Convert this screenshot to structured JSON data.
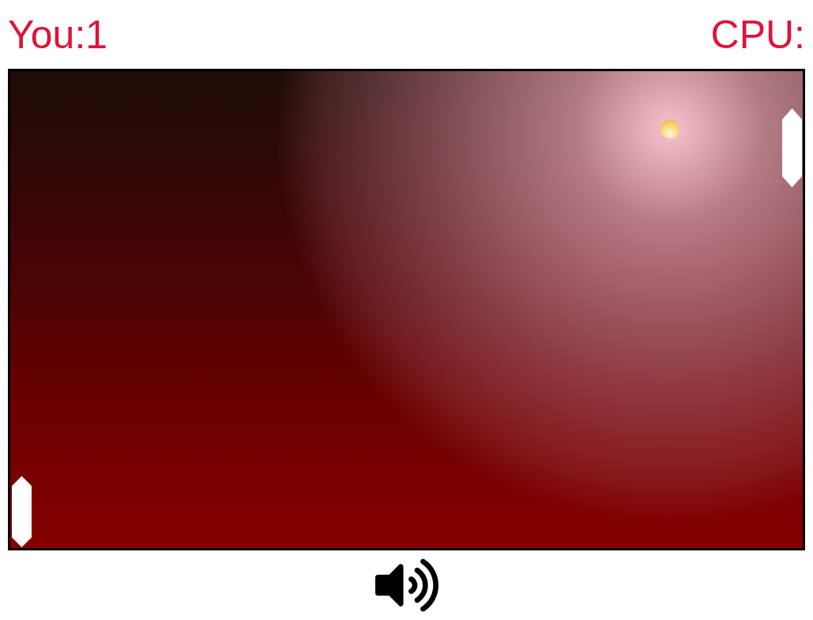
{
  "scoreboard": [
    {
      "label": "You:",
      "value": "1"
    },
    {
      "label": "CPU:",
      "value": ""
    }
  ],
  "sound": {
    "muted": false
  }
}
